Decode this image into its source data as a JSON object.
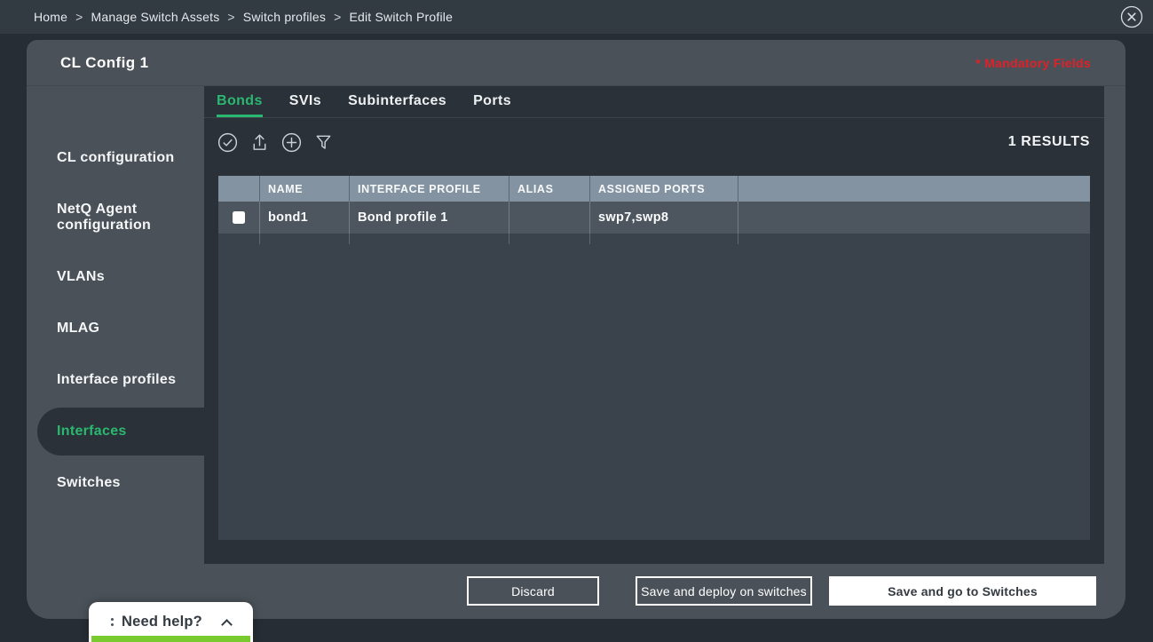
{
  "colors": {
    "accent_green": "#2ab871",
    "help_green": "#79ca2e",
    "mandatory_red": "#e02128",
    "table_header_bg": "#8493a1"
  },
  "breadcrumb": {
    "separator": ">",
    "items": [
      "Home",
      "Manage Switch Assets",
      "Switch profiles",
      "Edit Switch Profile"
    ]
  },
  "window": {
    "close_icon": "circled-x"
  },
  "modal": {
    "title": "CL Config 1",
    "mandatory_note": "* Mandatory Fields",
    "sidebar": {
      "items": [
        {
          "label": "CL configuration",
          "selected": false
        },
        {
          "label": "NetQ Agent configuration",
          "selected": false
        },
        {
          "label": "VLANs",
          "selected": false
        },
        {
          "label": "MLAG",
          "selected": false
        },
        {
          "label": "Interface profiles",
          "selected": false
        },
        {
          "label": "Interfaces",
          "selected": true
        },
        {
          "label": "Switches",
          "selected": false
        }
      ]
    },
    "tabs": [
      {
        "label": "Bonds",
        "active": true
      },
      {
        "label": "SVIs",
        "active": false
      },
      {
        "label": "Subinterfaces",
        "active": false
      },
      {
        "label": "Ports",
        "active": false
      }
    ],
    "toolbar": {
      "icons": [
        "select-all-icon",
        "upload-icon",
        "add-icon",
        "filter-icon"
      ],
      "results_label": "1 RESULTS"
    },
    "table": {
      "columns": [
        "NAME",
        "INTERFACE PROFILE",
        "ALIAS",
        "ASSIGNED PORTS"
      ],
      "rows": [
        {
          "checked": false,
          "name": "bond1",
          "interface_profile": "Bond profile 1",
          "alias": "",
          "assigned_ports": "swp7,swp8"
        }
      ]
    },
    "footer": {
      "discard_label": "Discard",
      "save_deploy_label": "Save and deploy on switches",
      "save_go_label": "Save and go to Switches"
    }
  },
  "help_widget": {
    "label": "Need help?",
    "icons": [
      "drag-handle-icon",
      "chevron-up-icon"
    ]
  }
}
